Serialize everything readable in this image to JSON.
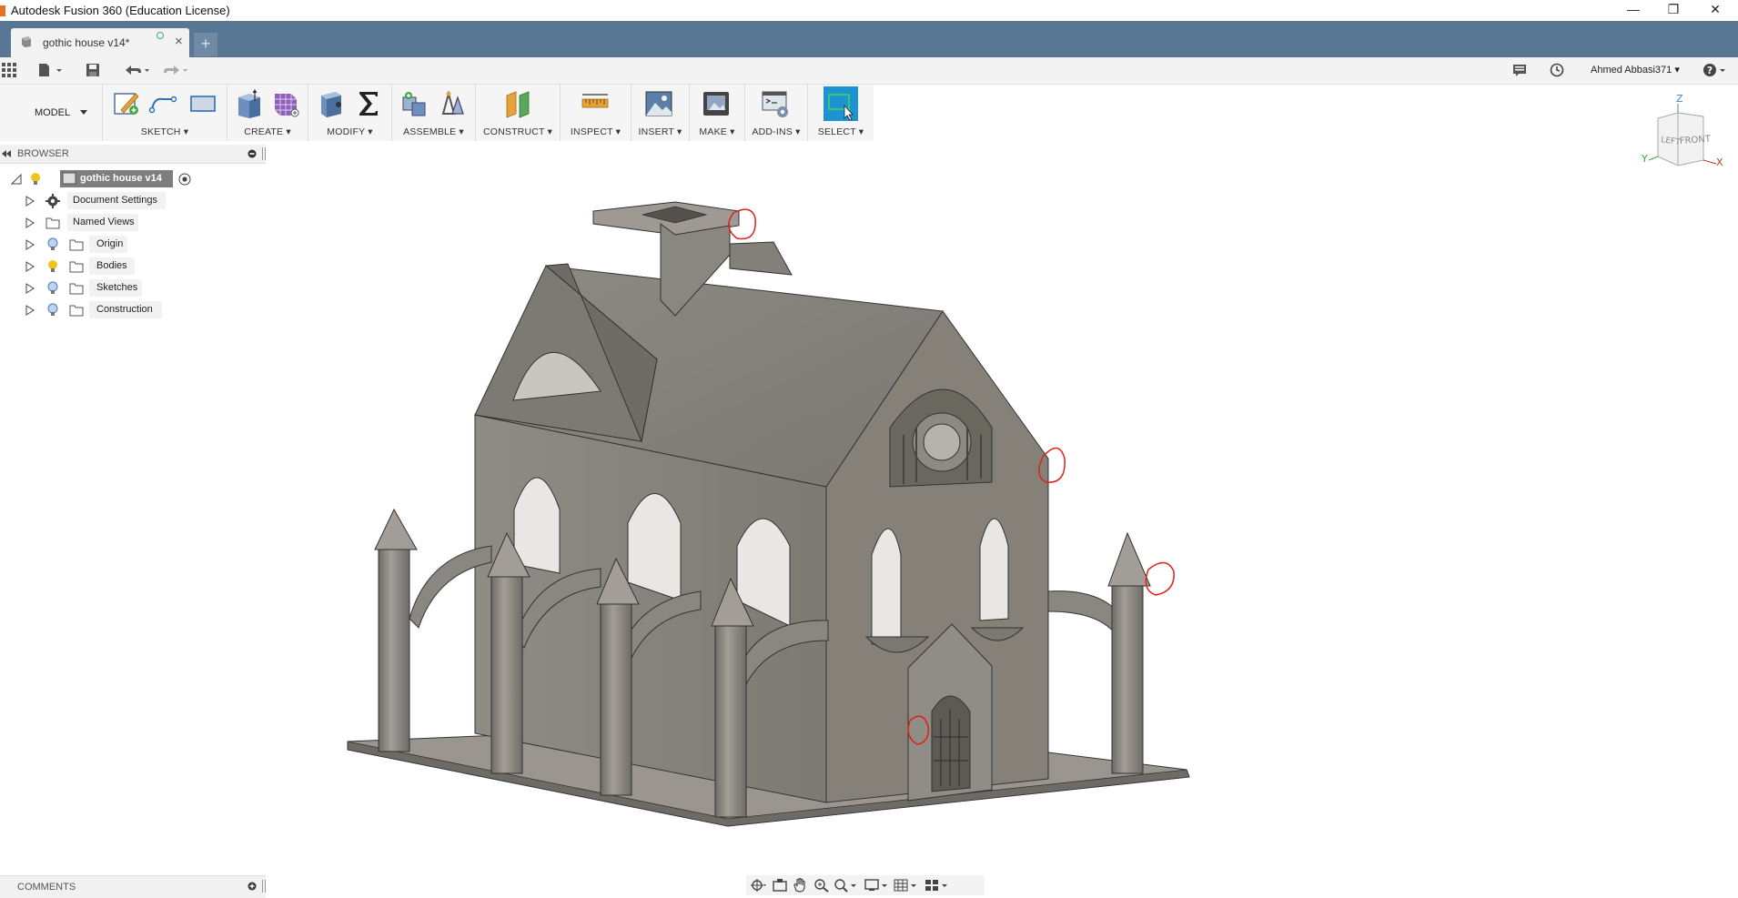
{
  "window": {
    "title": "Autodesk Fusion 360 (Education License)",
    "controls": [
      "minimize",
      "restore",
      "close"
    ]
  },
  "tabs": {
    "active": {
      "label": "gothic house v14*",
      "icon": "document-icon"
    },
    "new_tab": "+",
    "close_glyph": "×"
  },
  "quickbar": {
    "user": "Ahmed Abbasi371 ▾",
    "help": "?▾"
  },
  "toolbar": {
    "workspace": "MODEL",
    "groups": [
      {
        "id": "sketch",
        "label": "SKETCH ▾"
      },
      {
        "id": "create",
        "label": "CREATE ▾"
      },
      {
        "id": "modify",
        "label": "MODIFY ▾"
      },
      {
        "id": "assemble",
        "label": "ASSEMBLE ▾"
      },
      {
        "id": "construct",
        "label": "CONSTRUCT ▾"
      },
      {
        "id": "inspect",
        "label": "INSPECT ▾"
      },
      {
        "id": "insert",
        "label": "INSERT ▾"
      },
      {
        "id": "make",
        "label": "MAKE ▾"
      },
      {
        "id": "addins",
        "label": "ADD-INS ▾"
      },
      {
        "id": "select",
        "label": "SELECT ▾"
      }
    ]
  },
  "browser": {
    "title": "BROWSER",
    "root": "gothic house v14",
    "items": [
      {
        "label": "Document Settings",
        "icon": "gear-icon"
      },
      {
        "label": "Named Views",
        "icon": "folder-icon"
      },
      {
        "label": "Origin",
        "icon": "folder-icon",
        "visible_bulb": "blue"
      },
      {
        "label": "Bodies",
        "icon": "folder-icon",
        "visible_bulb": "yellow"
      },
      {
        "label": "Sketches",
        "icon": "folder-icon",
        "visible_bulb": "blue"
      },
      {
        "label": "Construction",
        "icon": "folder-icon",
        "visible_bulb": "blue"
      }
    ]
  },
  "comments": {
    "title": "COMMENTS"
  },
  "viewcube": {
    "z": "Z",
    "x": "X",
    "y": "Y",
    "left": "LEFT",
    "front": "FRONT"
  },
  "colors": {
    "tabbar": "#597794",
    "select_active": "#1d93d1",
    "model_body": "#8a8781",
    "annotation": "#e0201a"
  }
}
